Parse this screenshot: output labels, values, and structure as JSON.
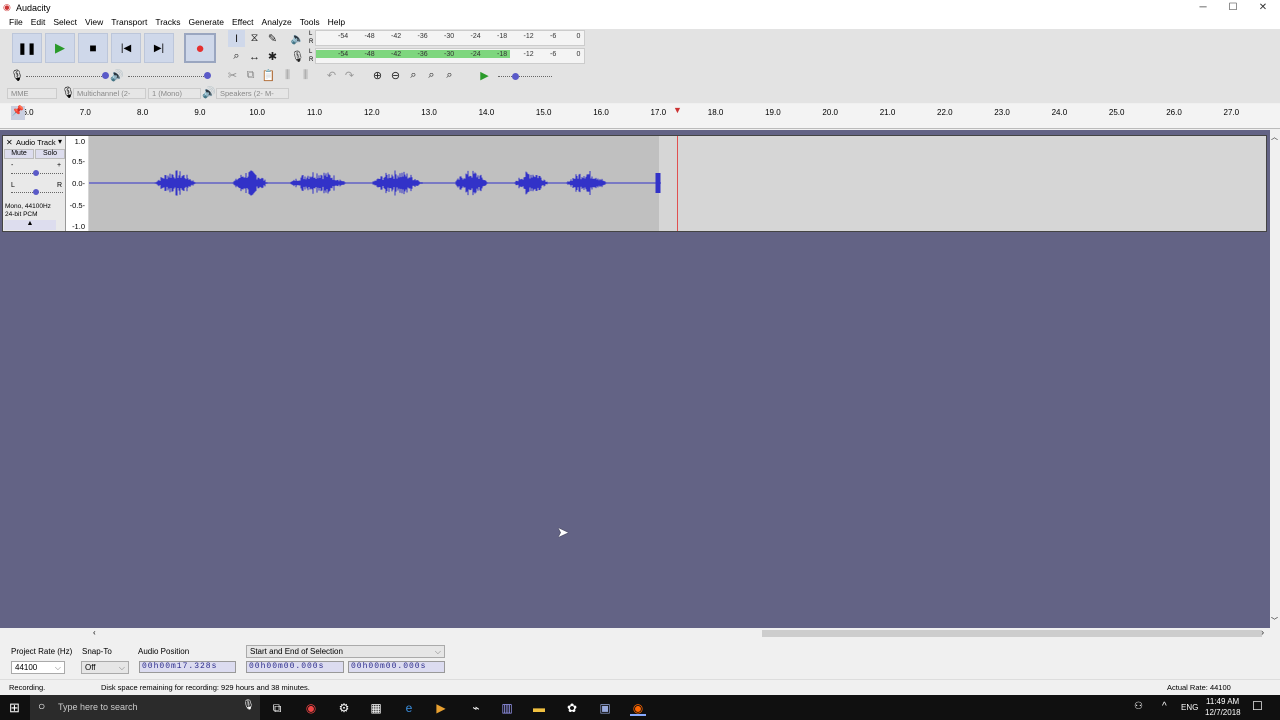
{
  "window": {
    "title": "Audacity",
    "minimize": "─",
    "maximize": "☐",
    "close": "✕"
  },
  "menu": [
    "File",
    "Edit",
    "Select",
    "View",
    "Transport",
    "Tracks",
    "Generate",
    "Effect",
    "Analyze",
    "Tools",
    "Help"
  ],
  "meters": {
    "ticks": [
      "-54",
      "-48",
      "-42",
      "-36",
      "-30",
      "-24",
      "-18",
      "-12",
      "-6",
      "0"
    ],
    "channel_l": "L",
    "channel_r": "R",
    "record_level": 0.72
  },
  "device": {
    "host": "MME",
    "input": "Multichannel (2-",
    "channels": "1 (Mono)",
    "output": "Speakers (2- M-"
  },
  "ruler": {
    "ticks": [
      "6.0",
      "7.0",
      "8.0",
      "9.0",
      "10.0",
      "11.0",
      "12.0",
      "13.0",
      "14.0",
      "15.0",
      "16.0",
      "17.0",
      "18.0",
      "19.0",
      "20.0",
      "21.0",
      "22.0",
      "23.0",
      "24.0",
      "25.0",
      "26.0",
      "27.0"
    ],
    "playhead_seconds": 17.33
  },
  "track": {
    "name": "Audio Track",
    "mute": "Mute",
    "solo": "Solo",
    "gain_minus": "-",
    "gain_plus": "+",
    "pan_l": "L",
    "pan_r": "R",
    "info1": "Mono, 44100Hz",
    "info2": "24-bit PCM",
    "scale": [
      "1.0",
      "0.5-",
      "0.0-",
      "-0.5-",
      "-1.0"
    ]
  },
  "selection_bar": {
    "rate_label": "Project Rate (Hz)",
    "rate": "44100",
    "snap_label": "Snap-To",
    "snap": "Off",
    "pos_label": "Audio Position",
    "position": "00h00m17.328s",
    "sel_label": "Start and End of Selection",
    "sel_start": "00h00m00.000s",
    "sel_end": "00h00m00.000s"
  },
  "status": {
    "state": "Recording.",
    "disk": "Disk space remaining for recording: 929 hours and 38 minutes.",
    "rate": "Actual Rate: 44100"
  },
  "taskbar": {
    "search": "Type here to search",
    "lang": "ENG",
    "time": "11:49 AM",
    "date": "12/7/2018"
  },
  "colors": {
    "waveform": "#3232c8",
    "workarea": "#636385",
    "record": "#e53030",
    "meter": "#7ed67e"
  }
}
